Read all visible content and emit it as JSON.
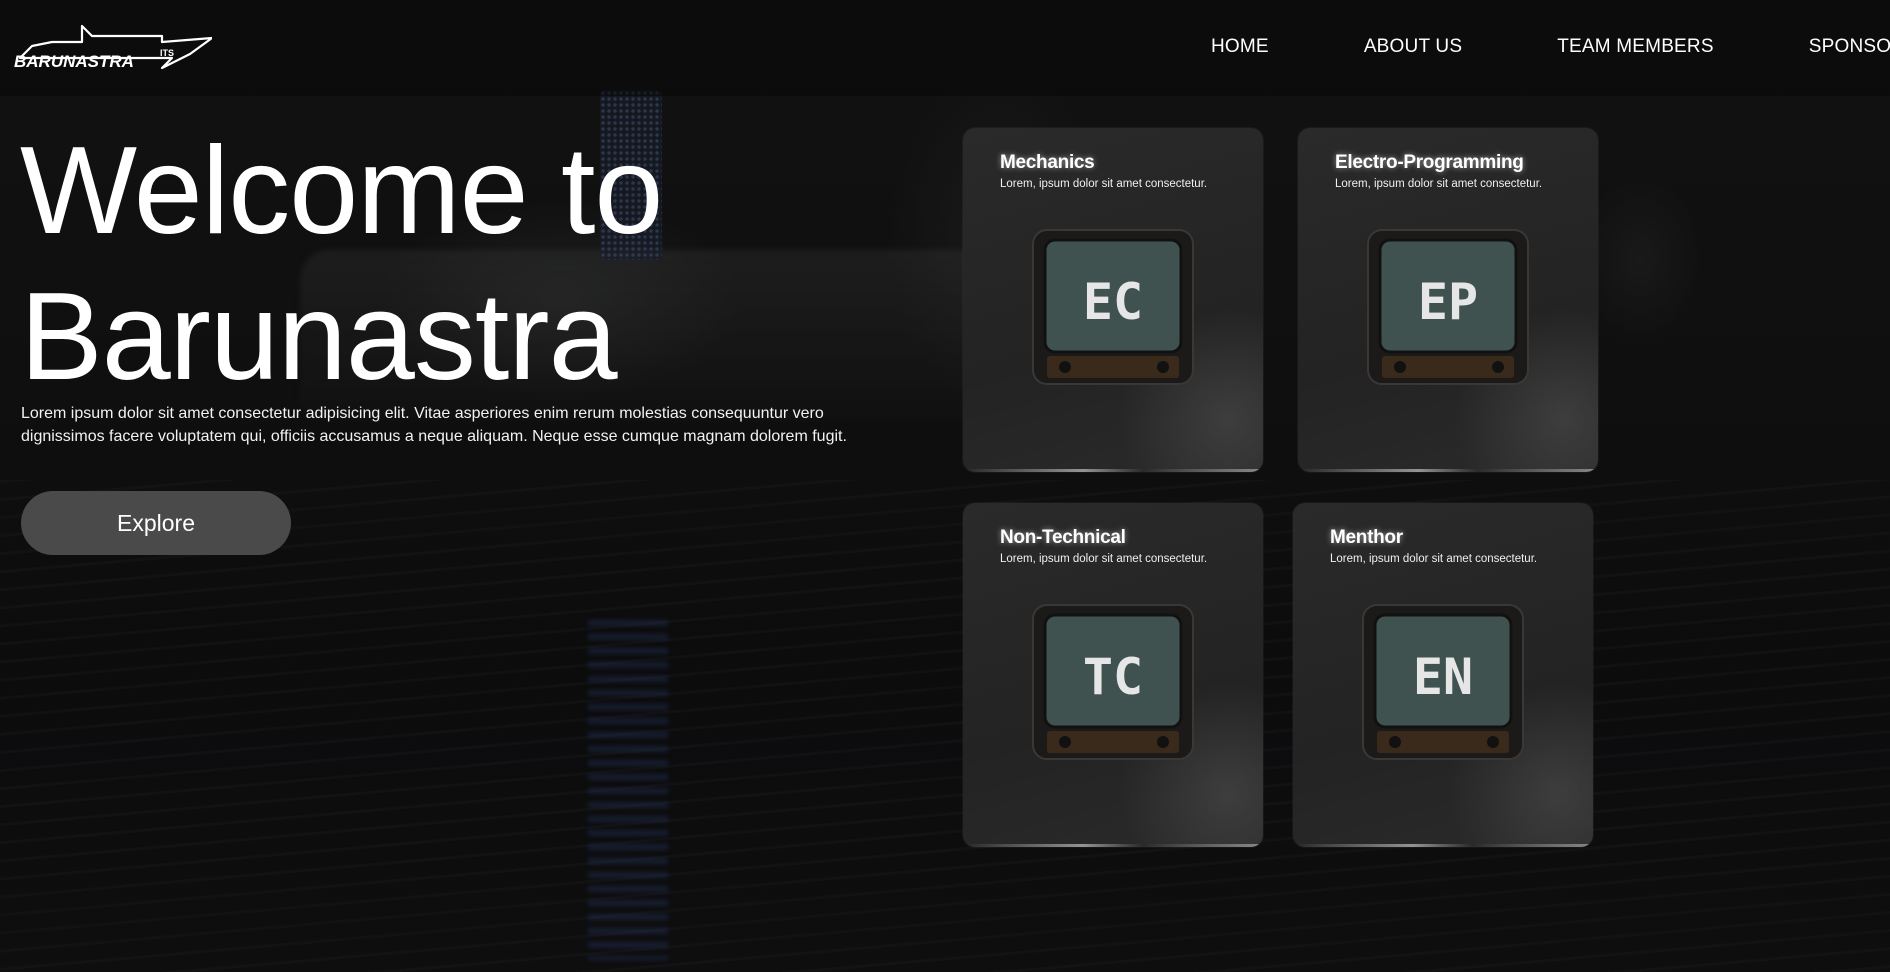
{
  "header": {
    "logo_text": "BARUNASTRA",
    "logo_suffix": "ITS",
    "nav": [
      "HOME",
      "ABOUT US",
      "TEAM MEMBERS",
      "SPONSORS"
    ]
  },
  "hero": {
    "title_line1": "Welcome to",
    "title_line2": "Barunastra",
    "description": "Lorem ipsum dolor sit amet consectetur adipisicing elit. Vitae asperiores enim rerum molestias consequuntur vero dignissimos facere voluptatem qui, officiis accusamus a neque aliquam. Neque esse cumque magnam dolorem fugit.",
    "cta_label": "Explore"
  },
  "cards": [
    {
      "title": "Mechanics",
      "subtitle": "Lorem, ipsum dolor sit amet consectetur.",
      "screen_text": "EC",
      "icon": "tv-icon"
    },
    {
      "title": "Electro-Programming",
      "subtitle": "Lorem, ipsum dolor sit amet consectetur.",
      "screen_text": "EP",
      "icon": "tv-icon"
    },
    {
      "title": "Non-Technical",
      "subtitle": "Lorem, ipsum dolor sit amet consectetur.",
      "screen_text": "TC",
      "icon": "tv-icon"
    },
    {
      "title": "Menthor",
      "subtitle": "Lorem, ipsum dolor sit amet consectetur.",
      "screen_text": "EN",
      "icon": "tv-icon"
    }
  ],
  "colors": {
    "background": "#0b0b0b",
    "card": "#262626",
    "button": "#4a4a4a",
    "tv_screen": "#3f5250"
  }
}
